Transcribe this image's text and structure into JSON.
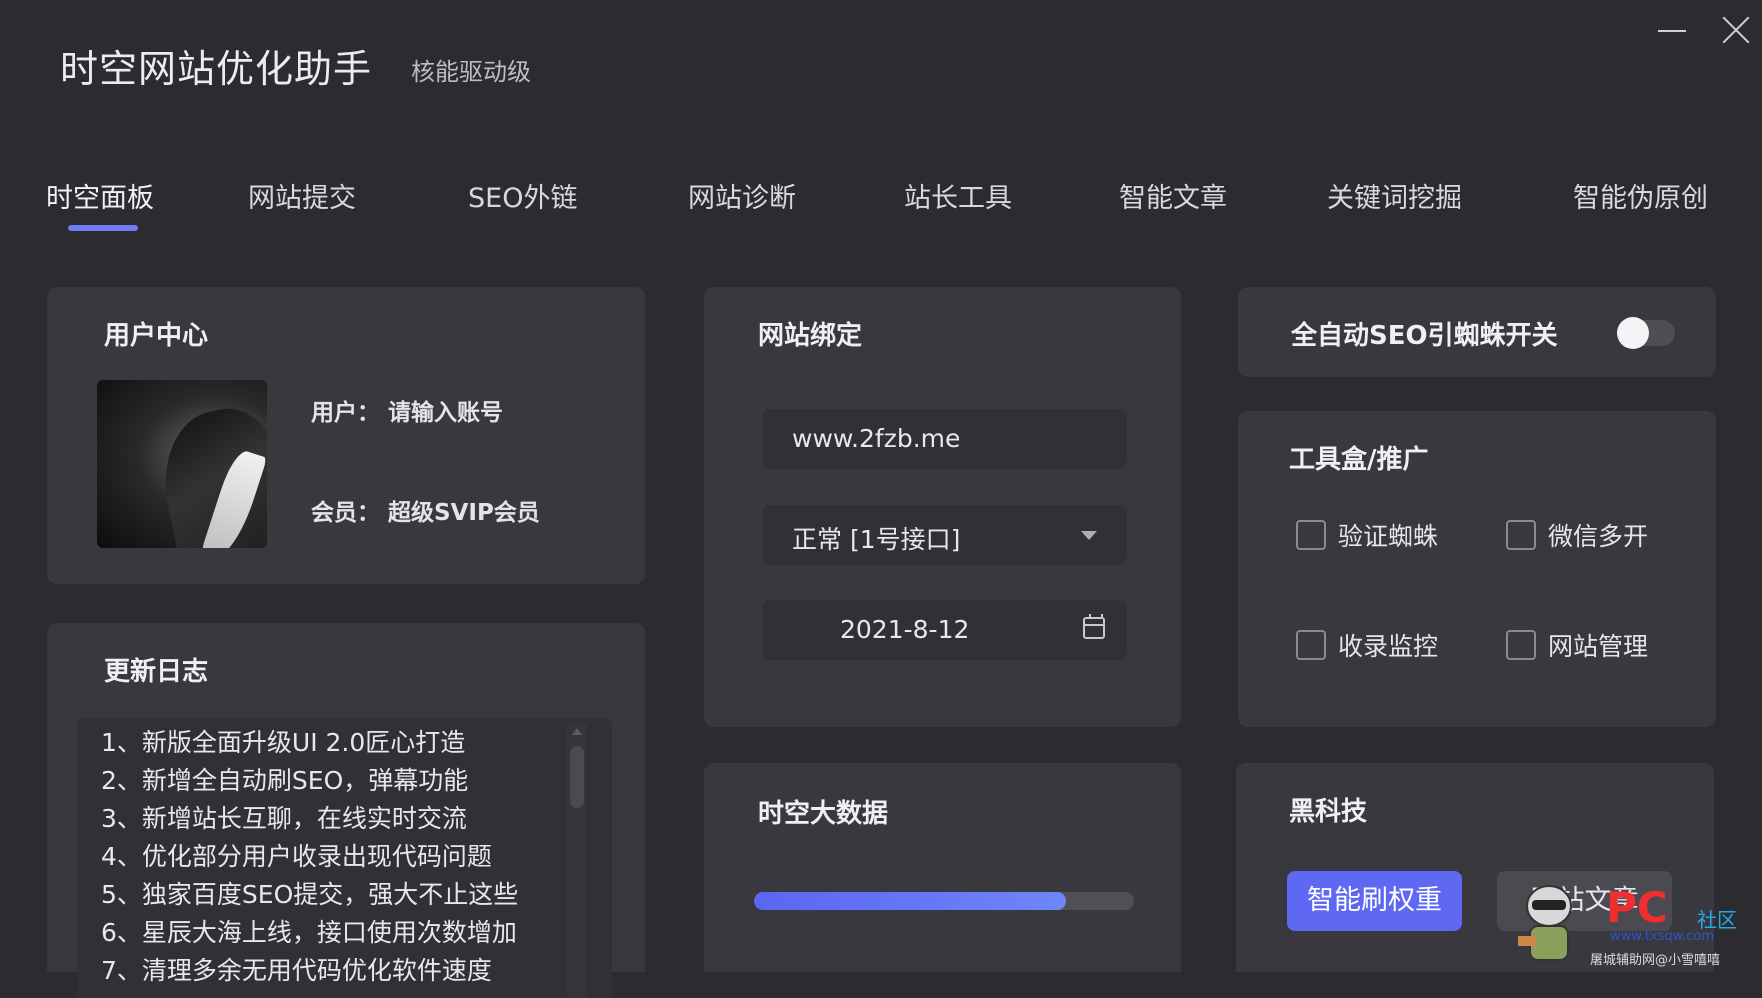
{
  "window": {
    "title": "时空网站优化助手",
    "subtitle": "核能驱动级"
  },
  "tabs": [
    {
      "label": "时空面板",
      "active": true
    },
    {
      "label": "网站提交"
    },
    {
      "label": "SEO外链"
    },
    {
      "label": "网站诊断"
    },
    {
      "label": "站长工具"
    },
    {
      "label": "智能文章"
    },
    {
      "label": "关键词挖掘"
    },
    {
      "label": "智能伪原创"
    }
  ],
  "user_center": {
    "title": "用户中心",
    "user_label": "用户：",
    "user_value": "请输入账号",
    "member_label": "会员：",
    "member_value": "超级SVIP会员"
  },
  "update_log": {
    "title": "更新日志",
    "items": [
      "1、新版全面升级UI 2.0匠心打造",
      "2、新增全自动刷SEO，弹幕功能",
      "3、新增站长互聊，在线实时交流",
      "4、优化部分用户收录出现代码问题",
      "5、独家百度SEO提交，强大不止这些",
      "6、星辰大海上线，接口使用次数增加",
      "7、清理多余无用代码优化软件速度"
    ]
  },
  "site_binding": {
    "title": "网站绑定",
    "domain": "www.2fzb.me",
    "interface": "正常 [1号接口]",
    "date": "2021-8-12"
  },
  "auto_seo": {
    "label": "全自动SEO引蜘蛛开关",
    "enabled": false
  },
  "toolbox": {
    "title": "工具盒/推广",
    "options": [
      {
        "label": "验证蜘蛛",
        "checked": false
      },
      {
        "label": "微信多开",
        "checked": false
      },
      {
        "label": "收录监控",
        "checked": false
      },
      {
        "label": "网站管理",
        "checked": false
      }
    ]
  },
  "big_data": {
    "title": "时空大数据",
    "progress": 0.82
  },
  "black_tech": {
    "title": "黑科技",
    "primary_button": "智能刷权重",
    "secondary_button": "网站文章"
  },
  "watermark": {
    "pc": "PC",
    "club": "社区",
    "url": "www.txsqw.com",
    "caption": "屠城辅助网@小雪嘻嘻"
  },
  "colors": {
    "background": "#2b2b30",
    "card": "#38383e",
    "accent": "#5e68f2"
  }
}
